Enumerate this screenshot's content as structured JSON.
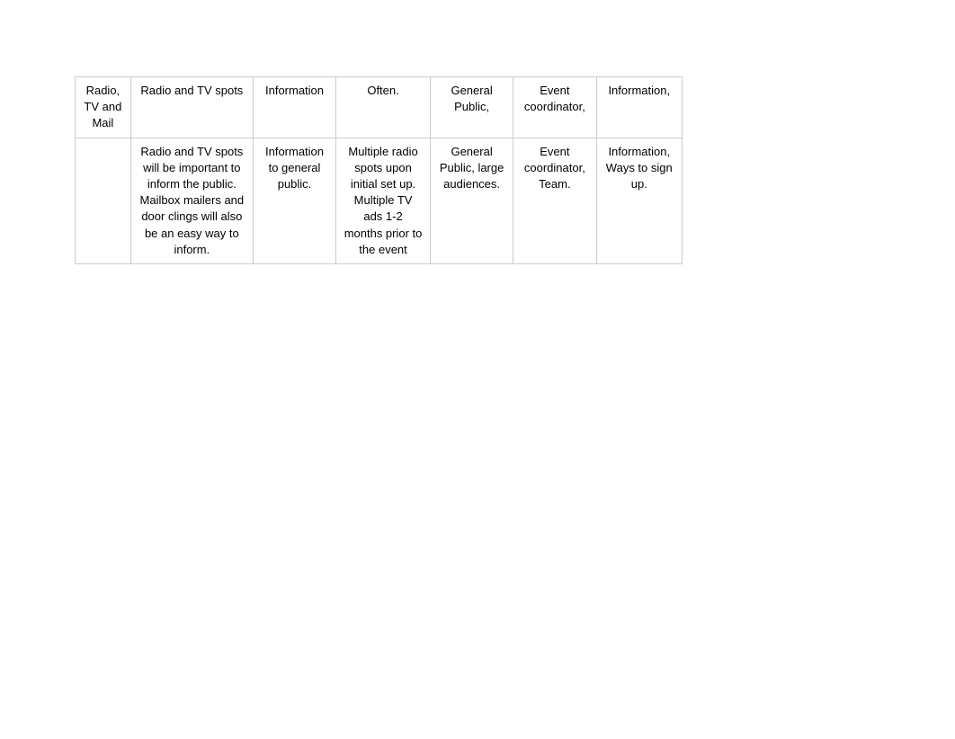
{
  "table": {
    "headers": [
      "Radio, TV and Mail",
      "Radio and TV spots",
      "Information",
      "Often.",
      "General Public,",
      "Event coordinator,",
      "Information,"
    ],
    "rows": [
      [
        "",
        "Radio and TV spots will be important to inform the public. Mailbox mailers and door clings will also be an easy way to inform.",
        "Information to general public.",
        "Multiple radio spots upon initial set up. Multiple TV ads 1-2 months prior to the event",
        "General Public, large audiences.",
        "Event coordinator, Team.",
        "Information, Ways to sign up."
      ]
    ]
  }
}
